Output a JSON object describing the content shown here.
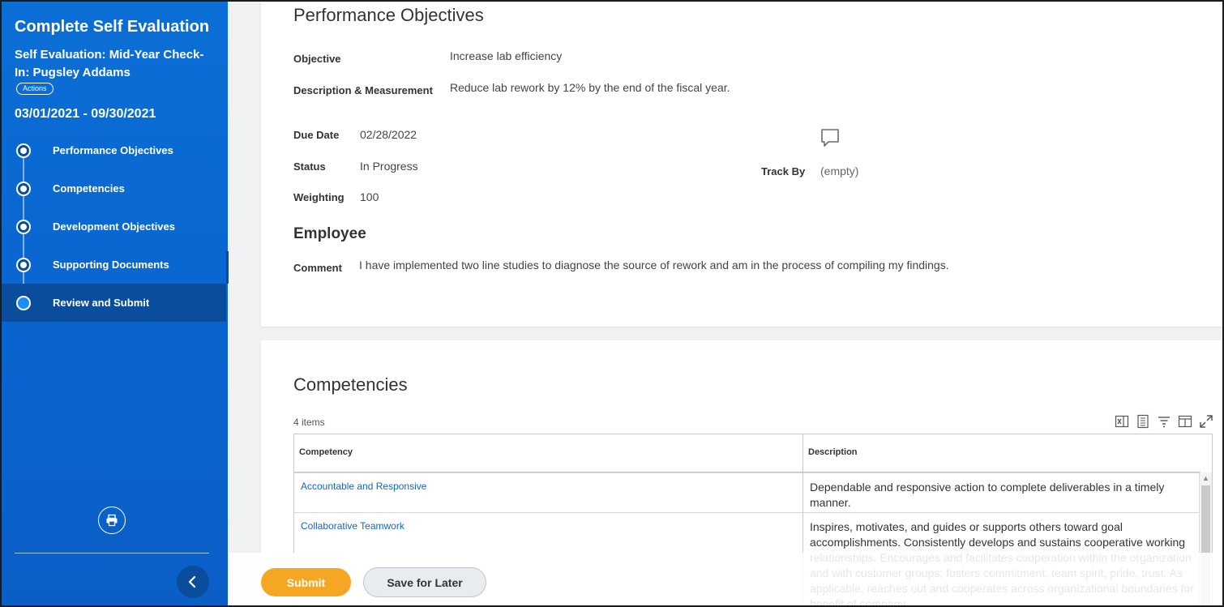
{
  "sidebar": {
    "title": "Complete Self Evaluation",
    "subtitle": "Self Evaluation: Mid-Year Check-In: Pugsley Addams",
    "actions_label": "Actions",
    "date_range": "03/01/2021 - 09/30/2021",
    "steps": [
      {
        "label": "Performance Objectives"
      },
      {
        "label": "Competencies"
      },
      {
        "label": "Development Objectives"
      },
      {
        "label": "Supporting Documents"
      },
      {
        "label": "Review and Submit"
      }
    ],
    "print_icon": "print-icon",
    "collapse_icon": "chevron-left-icon"
  },
  "objectives": {
    "heading": "Performance Objectives",
    "objective_label": "Objective",
    "objective_value": "Increase lab efficiency",
    "description_label": "Description & Measurement",
    "description_value": "Reduce lab rework by 12% by the end of the fiscal year.",
    "due_date_label": "Due Date",
    "due_date_value": "02/28/2022",
    "status_label": "Status",
    "status_value": "In Progress",
    "weighting_label": "Weighting",
    "weighting_value": "100",
    "track_by_label": "Track By",
    "track_by_value": "(empty)",
    "comment_icon": "comment-icon",
    "employee_heading": "Employee",
    "comment_label": "Comment",
    "comment_value": "I have implemented two line studies to diagnose the source of rework and am in the process of compiling my findings."
  },
  "competencies": {
    "heading": "Competencies",
    "count": "4 items",
    "columns": [
      "Competency",
      "Description"
    ],
    "rows": [
      {
        "competency": "Accountable and Responsive",
        "description": "Dependable and responsive action to complete deliverables in a timely manner."
      },
      {
        "competency": "Collaborative Teamwork",
        "description": "Inspires, motivates, and guides or supports others toward goal accomplishments. Consistently develops and sustains cooperative working relationships. Encourages and facilitates cooperation within the organization and with customer groups; fosters commitment, team spirit, pride, trust. As applicable, reaches out and cooperates across organizational boundaries for benefit of company."
      }
    ]
  },
  "footer": {
    "submit_label": "Submit",
    "save_label": "Save for Later"
  },
  "colors": {
    "sidebar": "#0a64cf",
    "active_step": "#0a4d9c",
    "submit": "#f5a623",
    "link": "#1565c0"
  }
}
